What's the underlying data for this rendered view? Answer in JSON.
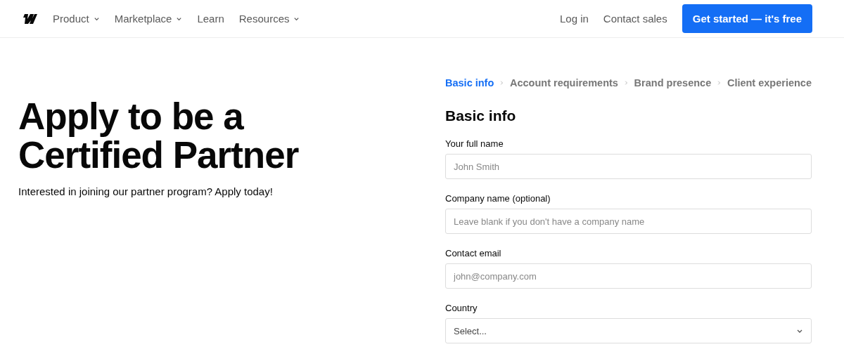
{
  "nav": {
    "items": [
      {
        "label": "Product",
        "dropdown": true
      },
      {
        "label": "Marketplace",
        "dropdown": true
      },
      {
        "label": "Learn",
        "dropdown": false
      },
      {
        "label": "Resources",
        "dropdown": true
      }
    ],
    "login": "Log in",
    "contact": "Contact sales",
    "cta": "Get started — it's free"
  },
  "hero": {
    "title": "Apply to be a Certified Partner",
    "subtitle": "Interested in joining our partner program? Apply today!"
  },
  "steps": [
    {
      "label": "Basic info",
      "selected": true
    },
    {
      "label": "Account requirements",
      "selected": false
    },
    {
      "label": "Brand presence",
      "selected": false
    },
    {
      "label": "Client experience",
      "selected": false
    }
  ],
  "form": {
    "title": "Basic info",
    "fields": [
      {
        "kind": "text",
        "label": "Your full name",
        "placeholder": "John Smith"
      },
      {
        "kind": "text",
        "label": "Company name (optional)",
        "placeholder": "Leave blank if you don't have a company name"
      },
      {
        "kind": "text",
        "label": "Contact email",
        "placeholder": "john@company.com"
      },
      {
        "kind": "select",
        "label": "Country",
        "placeholder": "Select..."
      }
    ]
  }
}
